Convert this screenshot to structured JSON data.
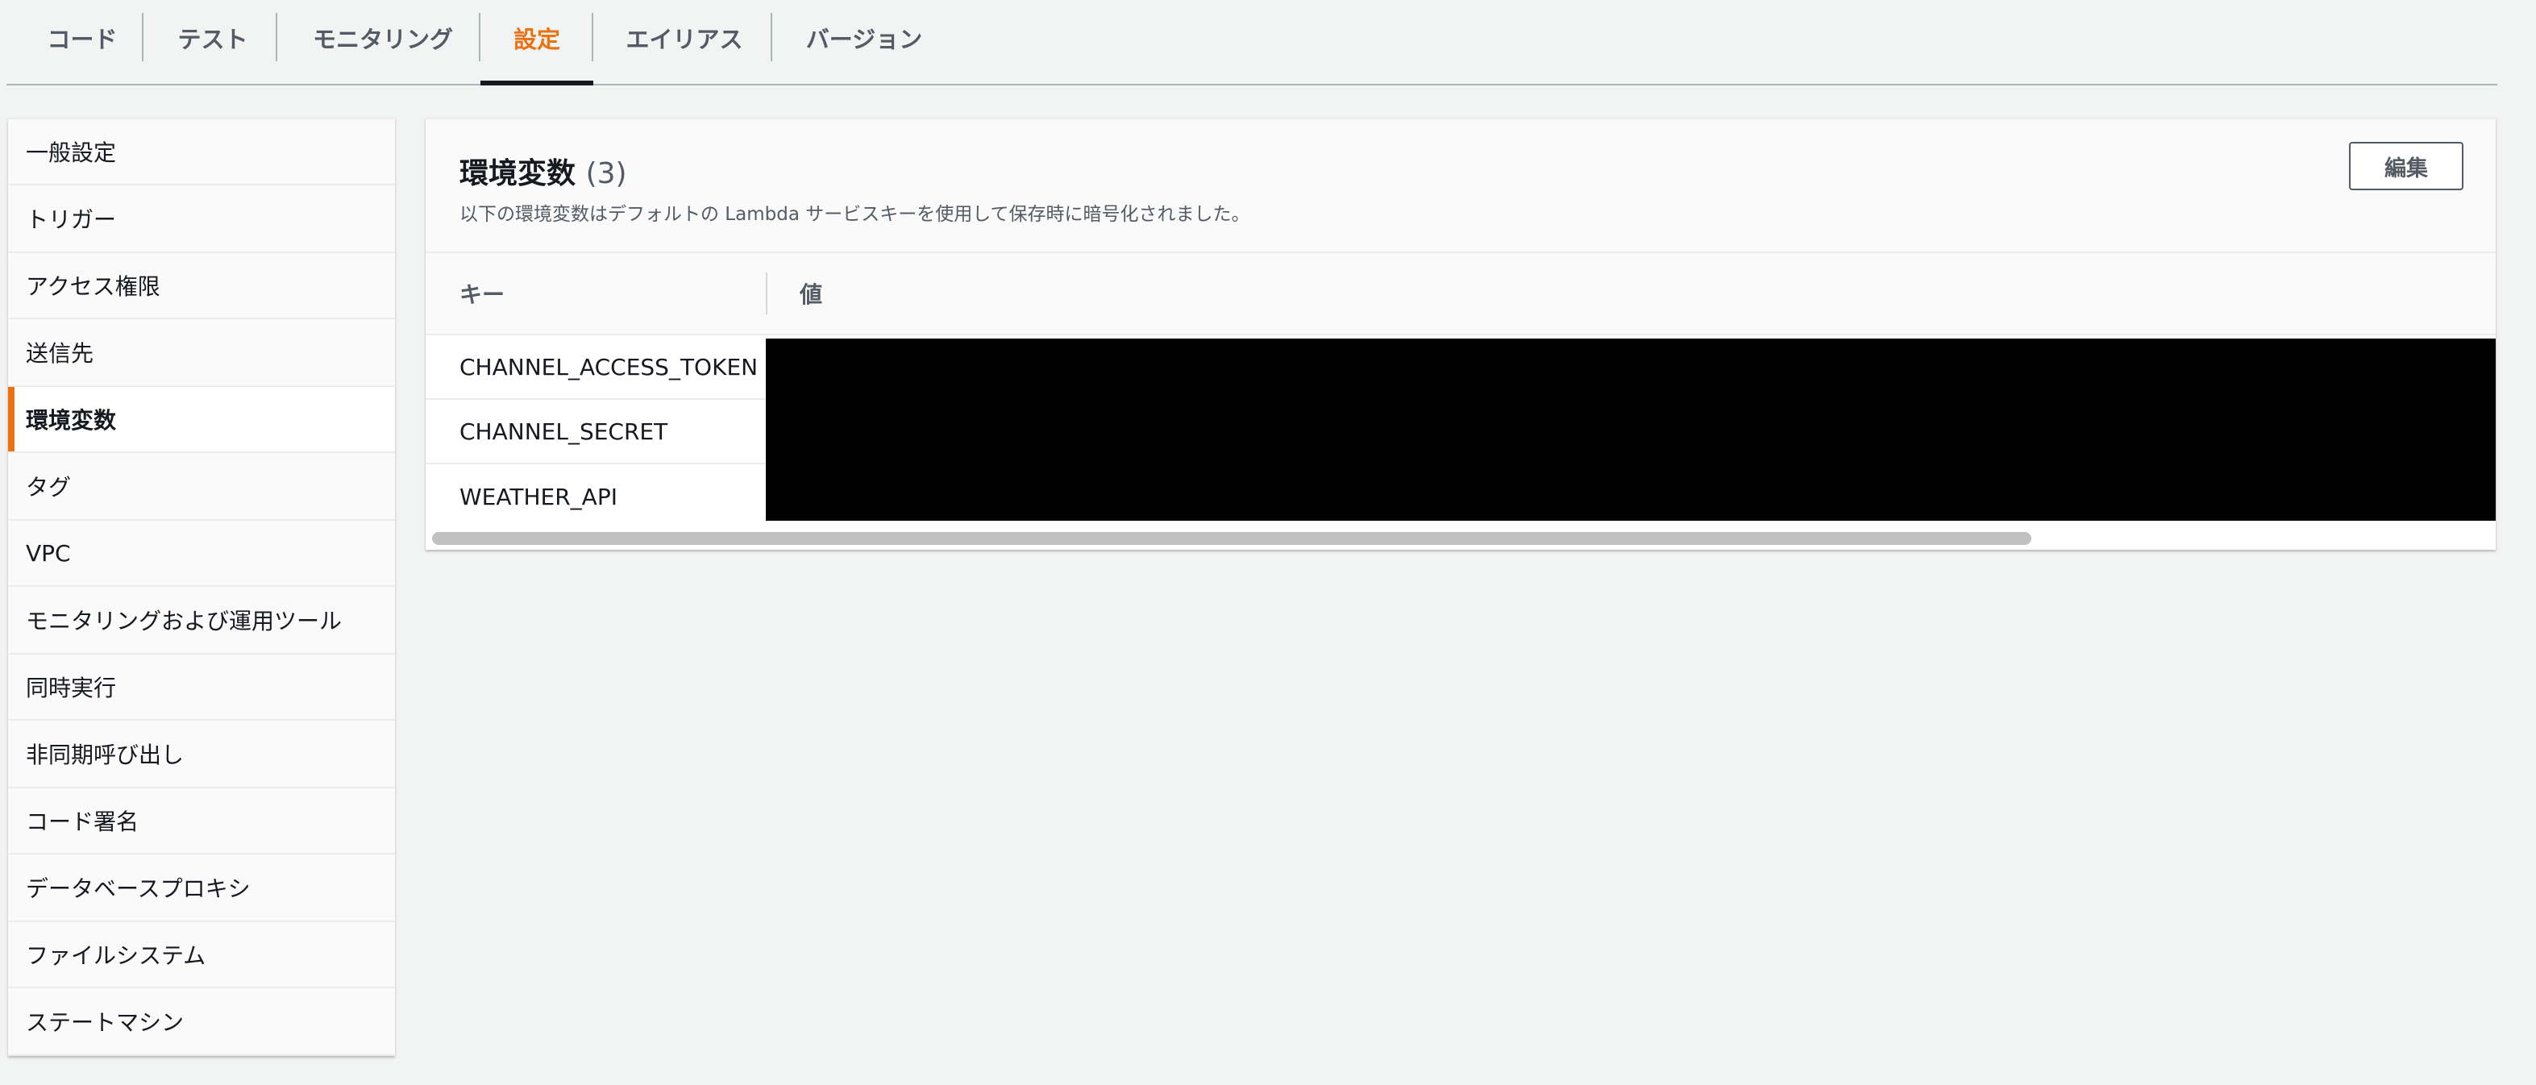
{
  "tabs": [
    {
      "label": "コード"
    },
    {
      "label": "テスト"
    },
    {
      "label": "モニタリング"
    },
    {
      "label": "設定"
    },
    {
      "label": "エイリアス"
    },
    {
      "label": "バージョン"
    }
  ],
  "sidebar": {
    "items": [
      {
        "label": "一般設定"
      },
      {
        "label": "トリガー"
      },
      {
        "label": "アクセス権限"
      },
      {
        "label": "送信先"
      },
      {
        "label": "環境変数"
      },
      {
        "label": "タグ"
      },
      {
        "label": "VPC"
      },
      {
        "label": "モニタリングおよび運用ツール"
      },
      {
        "label": "同時実行"
      },
      {
        "label": "非同期呼び出し"
      },
      {
        "label": "コード署名"
      },
      {
        "label": "データベースプロキシ"
      },
      {
        "label": "ファイルシステム"
      },
      {
        "label": "ステートマシン"
      }
    ]
  },
  "env_panel": {
    "title": "環境変数",
    "count": "(3)",
    "description": "以下の環境変数はデフォルトの Lambda サービスキーを使用して保存時に暗号化されました。",
    "edit_label": "編集",
    "columns": {
      "key": "キー",
      "value": "値"
    },
    "rows": [
      {
        "key": "CHANNEL_ACCESS_TOKEN"
      },
      {
        "key": "CHANNEL_SECRET"
      },
      {
        "key": "WEATHER_API"
      }
    ]
  },
  "colors": {
    "accent": "#ec7211",
    "background": "#f2f3f3",
    "text": "#16191f",
    "muted_text": "#545b64",
    "redaction": "#000000"
  }
}
